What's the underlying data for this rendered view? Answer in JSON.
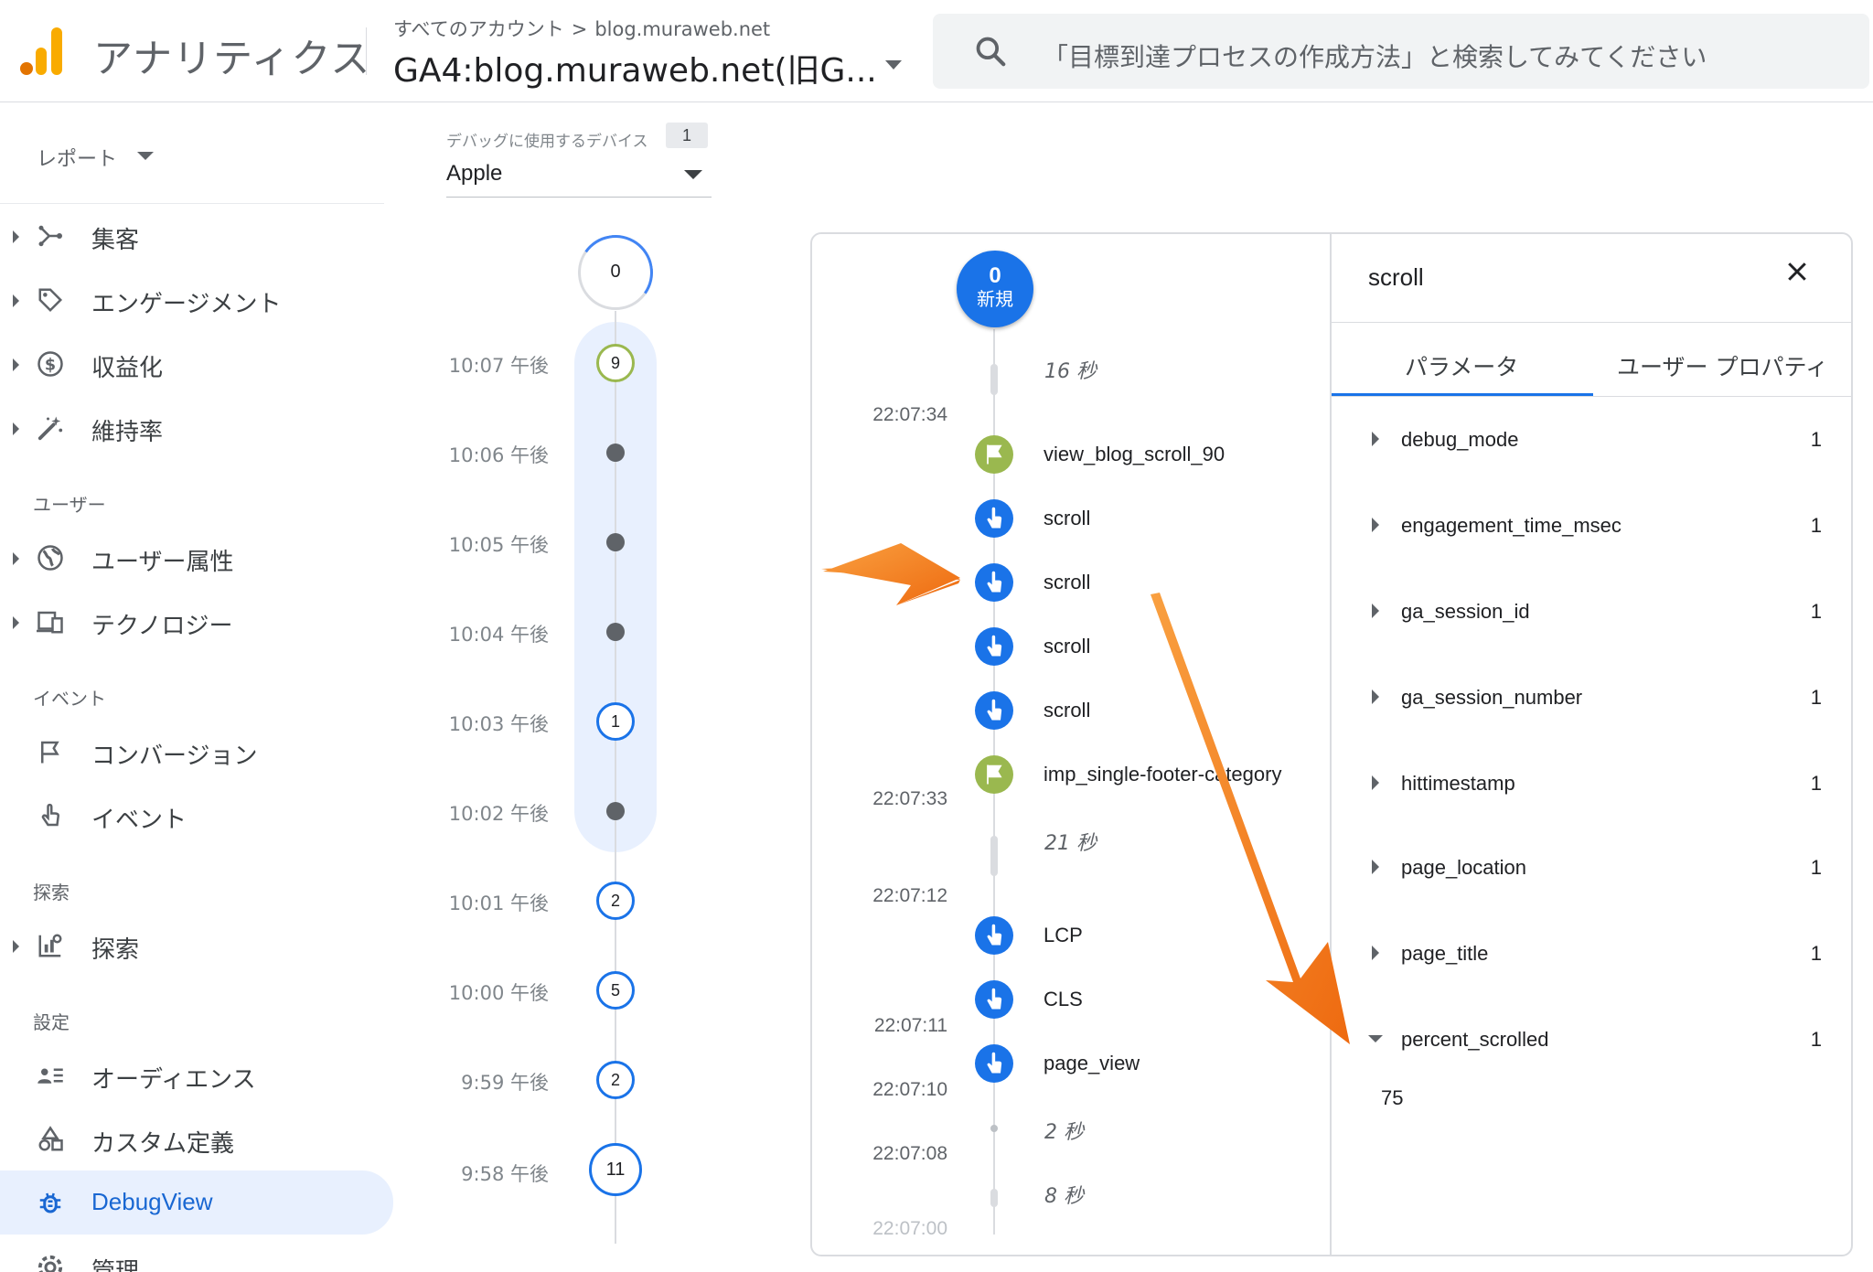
{
  "header": {
    "app_title": "アナリティクス",
    "breadcrumb_account": "すべてのアカウント",
    "breadcrumb_sep": ">",
    "breadcrumb_property": "blog.muraweb.net",
    "property_name": "GA4:blog.muraweb.net(旧G...",
    "search_placeholder": "「目標到達プロセスの作成方法」と検索してみてください"
  },
  "sidebar": {
    "reports_label": "レポート",
    "group1": [
      {
        "label": "集客",
        "icon": "acquisition-icon"
      },
      {
        "label": "エンゲージメント",
        "icon": "tag-icon"
      },
      {
        "label": "収益化",
        "icon": "dollar-icon"
      },
      {
        "label": "維持率",
        "icon": "magic-icon"
      }
    ],
    "section_user": "ユーザー",
    "group2": [
      {
        "label": "ユーザー属性",
        "icon": "globe-icon"
      },
      {
        "label": "テクノロジー",
        "icon": "devices-icon"
      }
    ],
    "section_event": "イベント",
    "group3": [
      {
        "label": "コンバージョン",
        "icon": "flag-icon"
      },
      {
        "label": "イベント",
        "icon": "touch-icon"
      }
    ],
    "section_explore": "探索",
    "group4": [
      {
        "label": "探索",
        "icon": "explore-icon"
      }
    ],
    "section_settings": "設定",
    "group5": [
      {
        "label": "オーディエンス",
        "icon": "audience-icon"
      },
      {
        "label": "カスタム定義",
        "icon": "shapes-icon"
      },
      {
        "label": "DebugView",
        "icon": "bug-icon"
      },
      {
        "label": "管理",
        "icon": "gear-icon"
      }
    ]
  },
  "device": {
    "label": "デバッグに使用するデバイス",
    "count": "1",
    "selected": "Apple"
  },
  "minutes": {
    "top_count": "0",
    "rows": [
      {
        "time": "10:07 午後",
        "count": "9"
      },
      {
        "time": "10:06 午後",
        "count": ""
      },
      {
        "time": "10:05 午後",
        "count": ""
      },
      {
        "time": "10:04 午後",
        "count": ""
      },
      {
        "time": "10:03 午後",
        "count": "1"
      },
      {
        "time": "10:02 午後",
        "count": ""
      },
      {
        "time": "10:01 午後",
        "count": "2"
      },
      {
        "time": "10:00 午後",
        "count": "5"
      },
      {
        "time": "9:59 午後",
        "count": "2"
      },
      {
        "time": "9:58 午後",
        "count": "11"
      }
    ]
  },
  "seconds": {
    "start_count": "0",
    "start_label": "新規",
    "times": [
      "22:07:34",
      "22:07:33",
      "22:07:12",
      "22:07:11",
      "22:07:10",
      "22:07:08",
      "22:07:00"
    ],
    "gaps": [
      "16 秒",
      "21 秒",
      "2 秒",
      "8 秒"
    ],
    "events": [
      {
        "name": "view_blog_scroll_90",
        "kind": "conversion"
      },
      {
        "name": "scroll",
        "kind": "event"
      },
      {
        "name": "scroll",
        "kind": "event"
      },
      {
        "name": "scroll",
        "kind": "event"
      },
      {
        "name": "scroll",
        "kind": "event"
      },
      {
        "name": "imp_single-footer-category",
        "kind": "conversion"
      },
      {
        "name": "LCP",
        "kind": "event"
      },
      {
        "name": "CLS",
        "kind": "event"
      },
      {
        "name": "page_view",
        "kind": "event"
      }
    ]
  },
  "detail": {
    "title": "scroll",
    "tab_params": "パラメータ",
    "tab_user_props": "ユーザー プロパティ",
    "params": [
      {
        "name": "debug_mode",
        "count": "1"
      },
      {
        "name": "engagement_time_msec",
        "count": "1"
      },
      {
        "name": "ga_session_id",
        "count": "1"
      },
      {
        "name": "ga_session_number",
        "count": "1"
      },
      {
        "name": "hittimestamp",
        "count": "1"
      },
      {
        "name": "page_location",
        "count": "1"
      },
      {
        "name": "page_title",
        "count": "1"
      },
      {
        "name": "percent_scrolled",
        "count": "1"
      }
    ],
    "expanded_value": "75"
  },
  "colors": {
    "accent_blue": "#1a73e8",
    "conversion_green": "#9ab84f",
    "annotation_orange": "#f47c1a",
    "active_nav_bg": "#e8f0fe"
  }
}
